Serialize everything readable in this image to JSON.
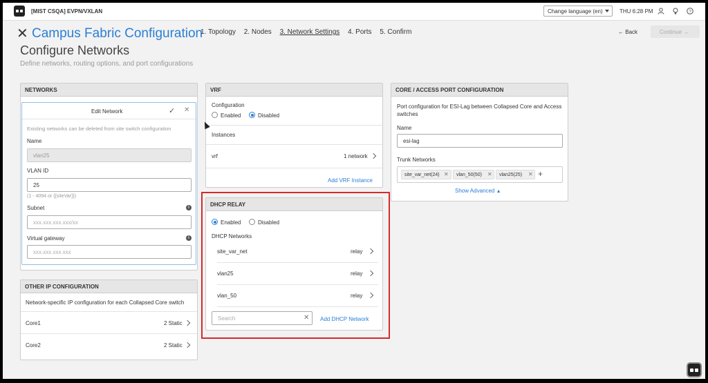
{
  "topbar": {
    "org": "[MIST CSQA] EVPN/VXLAN",
    "language": "Change language (en)",
    "time": "THU 6:28 PM"
  },
  "header": {
    "title": "Campus Fabric Configuration",
    "steps": [
      "1. Topology",
      "2. Nodes",
      "3. Network Settings",
      "4. Ports",
      "5. Confirm"
    ],
    "back": "Back",
    "continue": "Continue"
  },
  "page": {
    "heading": "Configure Networks",
    "subtitle": "Define networks, routing options, and port configurations"
  },
  "networks": {
    "header": "NETWORKS",
    "edit_title": "Edit Network",
    "note": "Existing networks can be deleted from site switch configuration",
    "name_label": "Name",
    "name_value": "vlan25",
    "vlan_label": "VLAN ID",
    "vlan_value": "25",
    "vlan_hint": "(1 - 4094 or {{siteVar}})",
    "subnet_label": "Subnet",
    "subnet_placeholder": "xxx.xxx.xxx.xxx/xx",
    "gateway_label": "Virtual gateway",
    "gateway_placeholder": "xxx.xxx.xxx.xxx"
  },
  "other_ip": {
    "header": "OTHER IP CONFIGURATION",
    "desc": "Network-specific IP configuration for each Collapsed Core switch",
    "rows": [
      {
        "name": "Core1",
        "value": "2 Static"
      },
      {
        "name": "Core2",
        "value": "2 Static"
      }
    ]
  },
  "vrf": {
    "header": "VRF",
    "config_label": "Configuration",
    "enabled": "Enabled",
    "disabled": "Disabled",
    "selected": "disabled",
    "instances_label": "Instances",
    "instance_name": "vrf",
    "instance_value": "1 network",
    "add_link": "Add VRF Instance"
  },
  "dhcp": {
    "header": "DHCP RELAY",
    "enabled": "Enabled",
    "disabled": "Disabled",
    "selected": "enabled",
    "networks_label": "DHCP Networks",
    "rows": [
      {
        "name": "site_var_net",
        "value": "relay"
      },
      {
        "name": "vlan25",
        "value": "relay"
      },
      {
        "name": "vlan_50",
        "value": "relay"
      }
    ],
    "search_placeholder": "Search",
    "add_link": "Add DHCP Network"
  },
  "core_access": {
    "header": "CORE / ACCESS PORT CONFIGURATION",
    "desc": "Port configuration for ESI-Lag between Collapsed Core and Access switches",
    "name_label": "Name",
    "name_value": "esi-lag",
    "trunk_label": "Trunk Networks",
    "chips": [
      "site_var_net(24)",
      "vlan_50(50)",
      "vlan25(25)"
    ],
    "show_advanced": "Show Advanced"
  },
  "colors": {
    "accent": "#2a7fd4",
    "highlight": "#d52a2a"
  }
}
